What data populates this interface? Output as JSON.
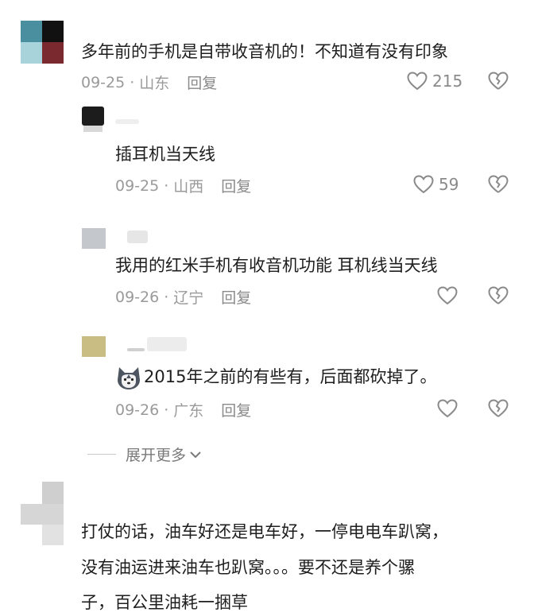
{
  "comments": [
    {
      "text": "多年前的手机是自带收音机的！不知道有没有印象",
      "date": "09-25",
      "location": "山东",
      "reply_label": "回复",
      "likes": "215",
      "replies": [
        {
          "text": "插耳机当天线",
          "date": "09-25",
          "location": "山西",
          "reply_label": "回复",
          "likes": "59"
        },
        {
          "text": "我用的红米手机有收音机功能  耳机线当天线",
          "date": "09-26",
          "location": "辽宁",
          "reply_label": "回复",
          "likes": ""
        },
        {
          "text": "2015年之前的有些有，后面都砍掉了。",
          "date": "09-26",
          "location": "广东",
          "reply_label": "回复",
          "likes": ""
        }
      ]
    },
    {
      "lines": [
        "打仗的话，油车好还是电车好，一停电电车趴窝，",
        "没有油运进来油车也趴窝。。。要不还是养个骡",
        "子，百公里油耗一捆草"
      ]
    }
  ],
  "expand_label": "展开更多",
  "icons": {
    "like": "heart-outline-icon",
    "dislike": "broken-heart-icon",
    "expand": "chevron-down-icon",
    "emoji": "husky-dog-emoji-icon"
  },
  "colors": {
    "text": "#1e1e1e",
    "meta": "#9a9a9a",
    "icon": "#8a8a8a"
  }
}
